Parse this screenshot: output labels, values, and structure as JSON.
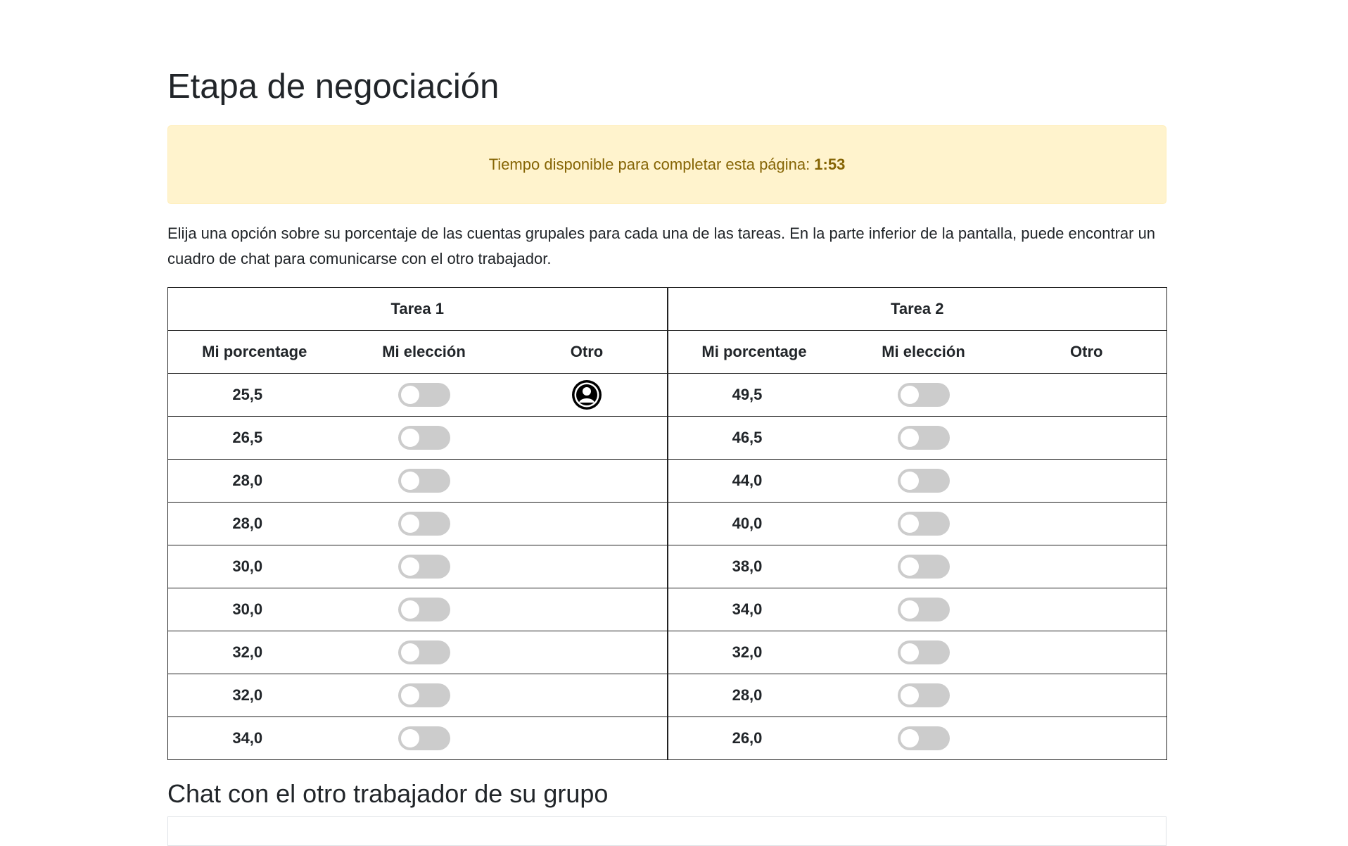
{
  "page": {
    "title": "Etapa de negociación",
    "timer_text": "Tiempo disponible para completar esta página:",
    "timer_value": "1:53",
    "instructions": "Elija una opción sobre su porcentaje de las cuentas grupales para cada una de las tareas. En la parte inferior de la pantalla, puede encontrar un cuadro de chat para comunicarse con el otro trabajador.",
    "chat_title": "Chat con el otro trabajador de su grupo"
  },
  "table": {
    "task1": "Tarea 1",
    "task2": "Tarea 2",
    "col_pct": "Mi porcentage",
    "col_choice": "Mi elección",
    "col_other": "Otro",
    "rows": [
      {
        "t1": "25,5",
        "t2": "49,5"
      },
      {
        "t1": "26,5",
        "t2": "46,5"
      },
      {
        "t1": "28,0",
        "t2": "44,0"
      },
      {
        "t1": "28,0",
        "t2": "40,0"
      },
      {
        "t1": "30,0",
        "t2": "38,0"
      },
      {
        "t1": "30,0",
        "t2": "34,0"
      },
      {
        "t1": "32,0",
        "t2": "32,0"
      },
      {
        "t1": "32,0",
        "t2": "28,0"
      },
      {
        "t1": "34,0",
        "t2": "26,0"
      }
    ],
    "other_marker_row": 0,
    "toggle_states": {
      "task1": [
        false,
        false,
        false,
        false,
        false,
        false,
        false,
        false,
        false
      ],
      "task2": [
        false,
        false,
        false,
        false,
        false,
        false,
        false,
        false,
        false
      ]
    }
  },
  "icons": {
    "other_choice": "user-circle-icon"
  },
  "colors": {
    "alert_bg": "#fff3cd",
    "alert_text": "#856404",
    "toggle_off": "#cccccc"
  }
}
